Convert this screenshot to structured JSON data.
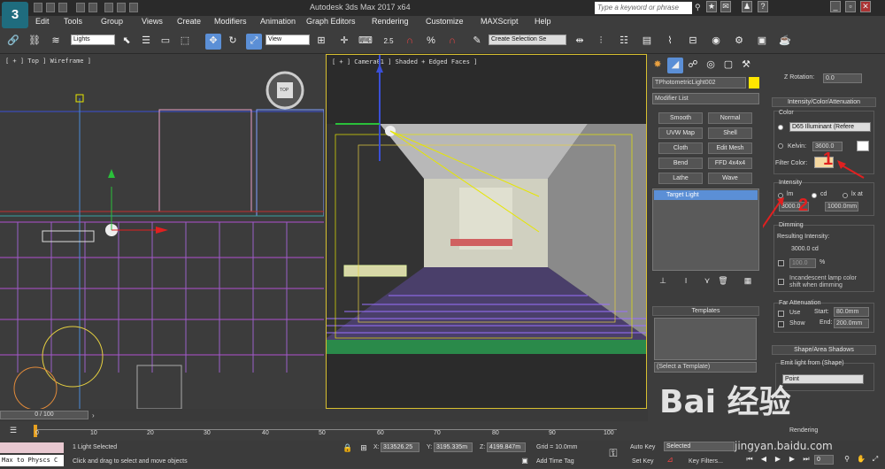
{
  "app": {
    "title": "Autodesk 3ds Max 2017 x64",
    "logo": "3"
  },
  "search": {
    "placeholder": "Type a keyword or phrase"
  },
  "menu": [
    "Edit",
    "Tools",
    "Group",
    "Views",
    "Create",
    "Modifiers",
    "Animation",
    "Graph Editors",
    "Rendering",
    "Customize",
    "MAXScript",
    "Help"
  ],
  "toolbar": {
    "selection_filter": "Lights",
    "ref_coord": "View",
    "snap_value": "2.5",
    "selection_set": "Create Selection Se"
  },
  "viewports": {
    "left_label": "[ + ] Top ] Wireframe ]",
    "center_label": "[ + ] Camera01 ] Shaded + Edged Faces ]",
    "viewcube": "TOP"
  },
  "command_panel": {
    "object_name": "TPhotometricLight002",
    "modifier_list": "Modifier List",
    "buttons": [
      "Smooth",
      "Normal",
      "UVW Map",
      "Shell",
      "Cloth",
      "Edit Mesh",
      "Bend",
      "FFD 4x4x4",
      "Lathe",
      "Wave"
    ],
    "stack_item": "Target Light",
    "templates_header": "Templates",
    "templates_select": "(Select a Template)"
  },
  "rollout": {
    "z_rotation_label": "Z Rotation:",
    "z_rotation_value": "0.0",
    "intensity_header": "Intensity/Color/Attenuation",
    "color_group": "Color",
    "color_preset": "D65 Illuminant (Refere",
    "kelvin_label": "Kelvin:",
    "kelvin_value": "3600.0",
    "filter_color_label": "Filter Color:",
    "intensity_group": "Intensity",
    "unit_lm": "lm",
    "unit_cd": "cd",
    "unit_lx": "lx at",
    "intensity_value": "3000.0",
    "distance_value": "1000.0mm",
    "dimming_group": "Dimming",
    "resulting_label": "Resulting Intensity:",
    "resulting_value": "3000.0 cd",
    "dim_percent": "100.0",
    "percent_sign": "%",
    "incandescent": "Incandescent lamp color shift when dimming",
    "far_group": "Far Attenuation",
    "use_label": "Use",
    "show_label": "Show",
    "start_label": "Start:",
    "start_value": "80.0mm",
    "end_label": "End:",
    "end_value": "200.0mm",
    "shadows_header": "Shape/Area Shadows",
    "emit_label": "Emit light from (Shape)",
    "emit_value": "Point",
    "rendering_label": "Rendering",
    "annotation_1": "1",
    "annotation_2": "2"
  },
  "timeline": {
    "frame": "0 / 100",
    "ticks": [
      "0",
      "10",
      "20",
      "30",
      "40",
      "50",
      "60",
      "70",
      "80",
      "90",
      "100"
    ]
  },
  "status": {
    "script_label": "Max to Physcs C",
    "selected": "1 Light Selected",
    "prompt": "Click and drag to select and move objects",
    "x_label": "X:",
    "x_value": "313526.25",
    "y_label": "Y:",
    "y_value": "3195.335m",
    "z_label": "Z:",
    "z_value": "4199.847m",
    "grid": "Grid = 10.0mm",
    "add_time_tag": "Add Time Tag",
    "auto_key": "Auto Key",
    "set_key": "Set Key",
    "key_mode": "Selected",
    "key_filters": "Key Filters...",
    "frame_value": "0"
  },
  "watermark": {
    "text": "Bai 经验",
    "url": "jingyan.baidu.com"
  },
  "colors": {
    "accent_blue": "#5b8fd6",
    "arrow_red": "#e02020",
    "light_yellow": "#ffe600",
    "filter_swatch": "#f5d8a0"
  }
}
